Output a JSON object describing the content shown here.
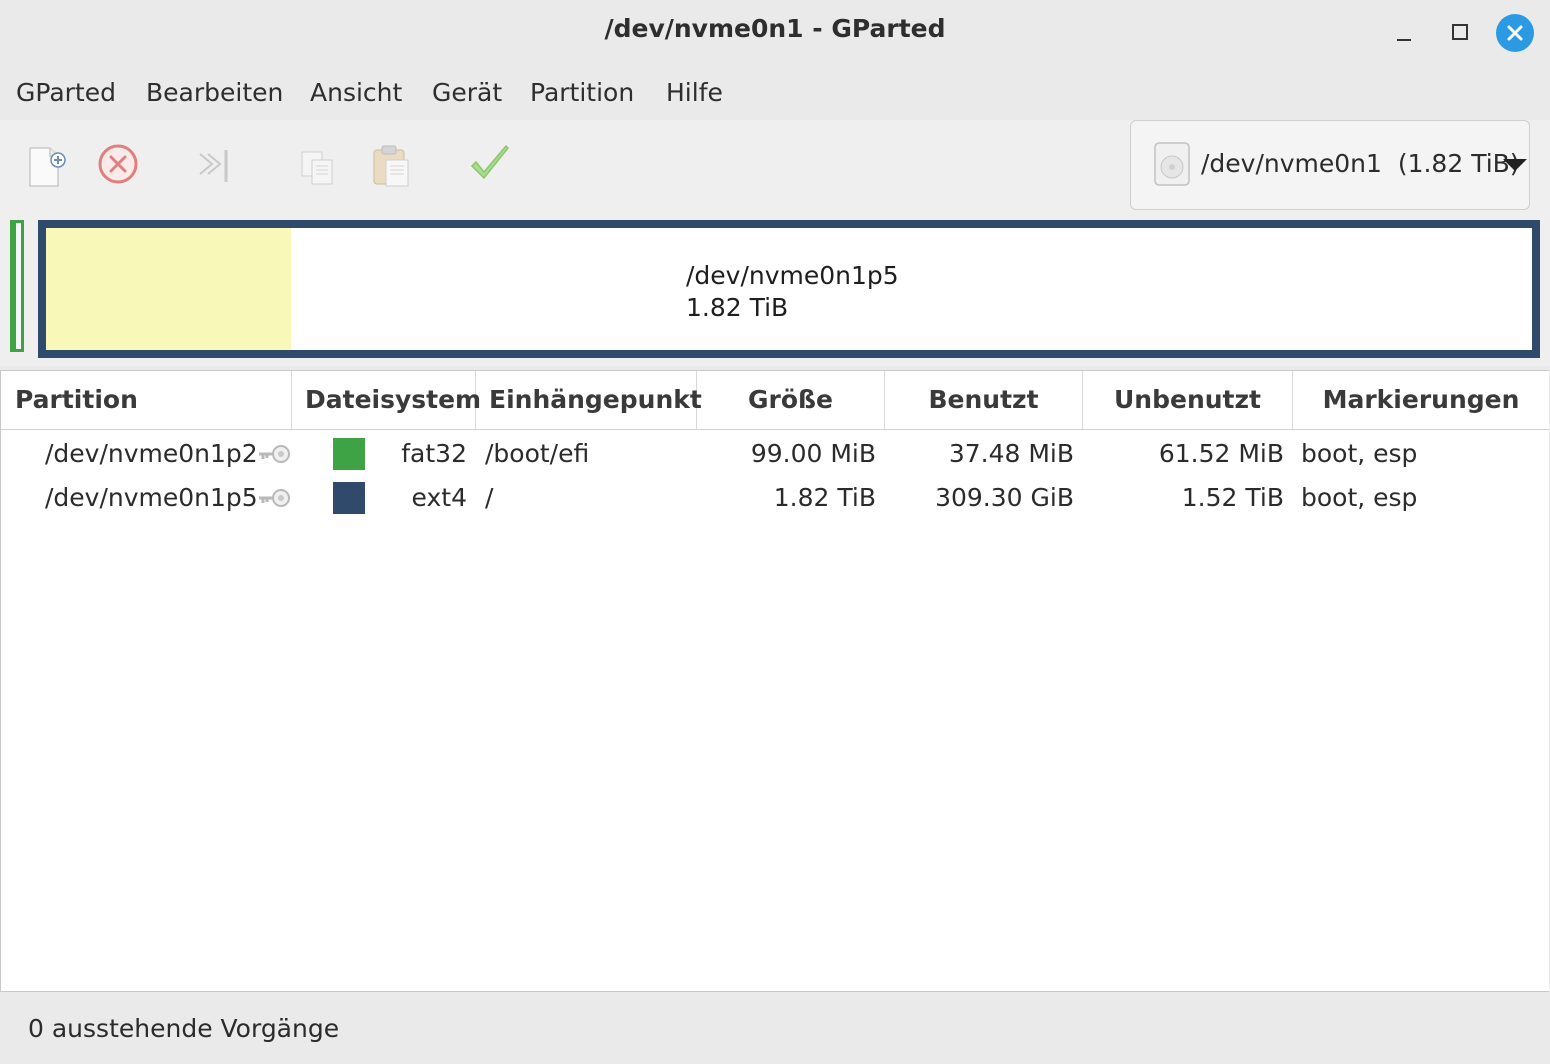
{
  "window": {
    "title": "/dev/nvme0n1 - GParted"
  },
  "menu": [
    "GParted",
    "Bearbeiten",
    "Ansicht",
    "Gerät",
    "Partition",
    "Hilfe"
  ],
  "toolbar": {
    "icons": [
      "new-partition-icon",
      "delete-icon",
      "apply-resize-icon",
      "copy-icon",
      "paste-icon",
      "apply-icon"
    ]
  },
  "device": {
    "name": "/dev/nvme0n1",
    "size": "(1.82 TiB)"
  },
  "map": {
    "selected_name": "/dev/nvme0n1p5",
    "selected_size": "1.82 TiB",
    "used_fraction": 0.165,
    "colors": {
      "fat32": "#3ea345",
      "ext4": "#2f4a6b",
      "used": "#f8f8b8"
    }
  },
  "table": {
    "columns": [
      "Partition",
      "Dateisystem",
      "Einhängepunkt",
      "Größe",
      "Benutzt",
      "Unbenutzt",
      "Markierungen"
    ],
    "rows": [
      {
        "partition": "/dev/nvme0n1p2",
        "color": "#3ea345",
        "fs": "fat32",
        "mount": "/boot/efi",
        "size": "99.00 MiB",
        "used": "37.48 MiB",
        "unused": "61.52 MiB",
        "flags": "boot, esp"
      },
      {
        "partition": "/dev/nvme0n1p5",
        "color": "#2f4a6b",
        "fs": "ext4",
        "mount": "/",
        "size": "1.82 TiB",
        "used": "309.30 GiB",
        "unused": "1.52 TiB",
        "flags": "boot, esp"
      }
    ]
  },
  "status": "0 ausstehende Vorgänge"
}
